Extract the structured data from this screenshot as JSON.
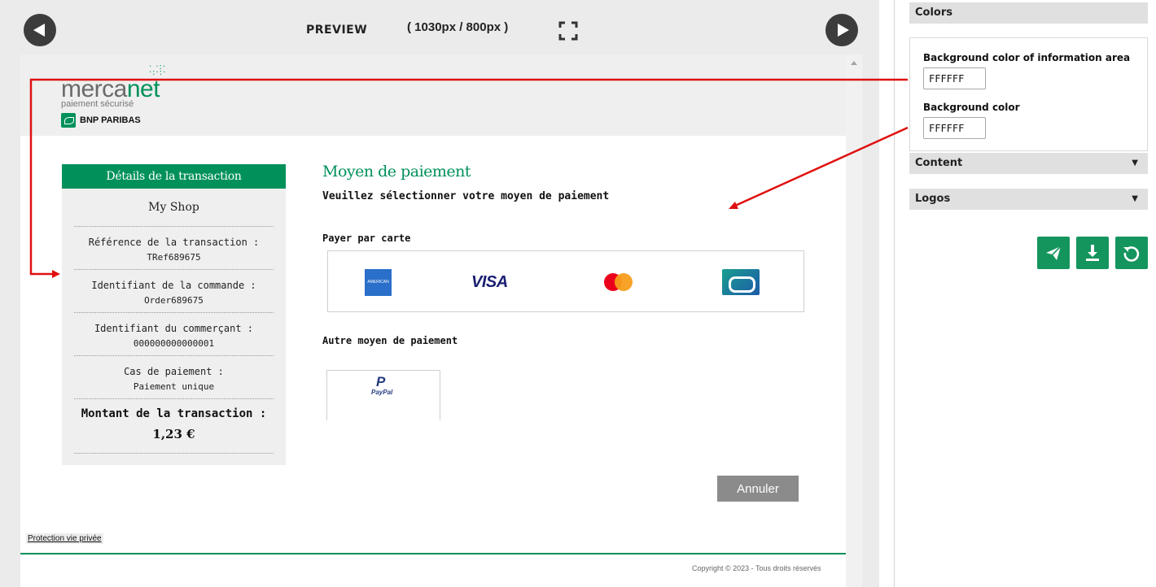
{
  "preview": {
    "label": "PREVIEW",
    "size": "( 1030px / 800px )"
  },
  "merchant_page": {
    "logo": {
      "word_prefix": "merca",
      "word_suffix": "net",
      "subtitle": "paiement sécurisé",
      "bank": "BNP PARIBAS"
    },
    "details": {
      "header": "Détails de la transaction",
      "shop": "My Shop",
      "rows": [
        {
          "label": "Référence de la transaction :",
          "value": "TRef689675"
        },
        {
          "label": "Identifiant de la commande :",
          "value": "Order689675"
        },
        {
          "label": "Identifiant du commerçant :",
          "value": "000000000000001"
        },
        {
          "label": "Cas de paiement :",
          "value": "Paiement unique"
        }
      ],
      "amount_label": "Montant de la transaction :",
      "amount_value": "1,23 €"
    },
    "payment": {
      "title": "Moyen de paiement",
      "subtitle": "Veuillez sélectionner votre moyen de paiement",
      "card_label": "Payer par carte",
      "cards": [
        "amex-logo",
        "visa-logo",
        "mastercard-logo",
        "cb-logo"
      ],
      "visa_text": "VISA",
      "amex_text": "AMERICAN EXPRESS",
      "other_label": "Autre moyen de paiement",
      "paypal_mark": "P",
      "paypal_word": "PayPal"
    },
    "cancel_label": "Annuler",
    "privacy_link": "Protection vie privée",
    "copyright": "Copyright © 2023 - Tous droits réservés",
    "brand_green": "#00915a"
  },
  "settings": {
    "sections": {
      "colors": "Colors",
      "content": "Content",
      "logos": "Logos"
    },
    "collapsed_arrow": "▼",
    "fields": [
      {
        "label": "Background color of information area",
        "value": "FFFFFF"
      },
      {
        "label": "Background color",
        "value": "FFFFFF"
      }
    ],
    "action_color": "#15955e",
    "actions": [
      "send-icon",
      "download-icon",
      "reset-icon"
    ]
  },
  "annotation_color": "#e01010"
}
